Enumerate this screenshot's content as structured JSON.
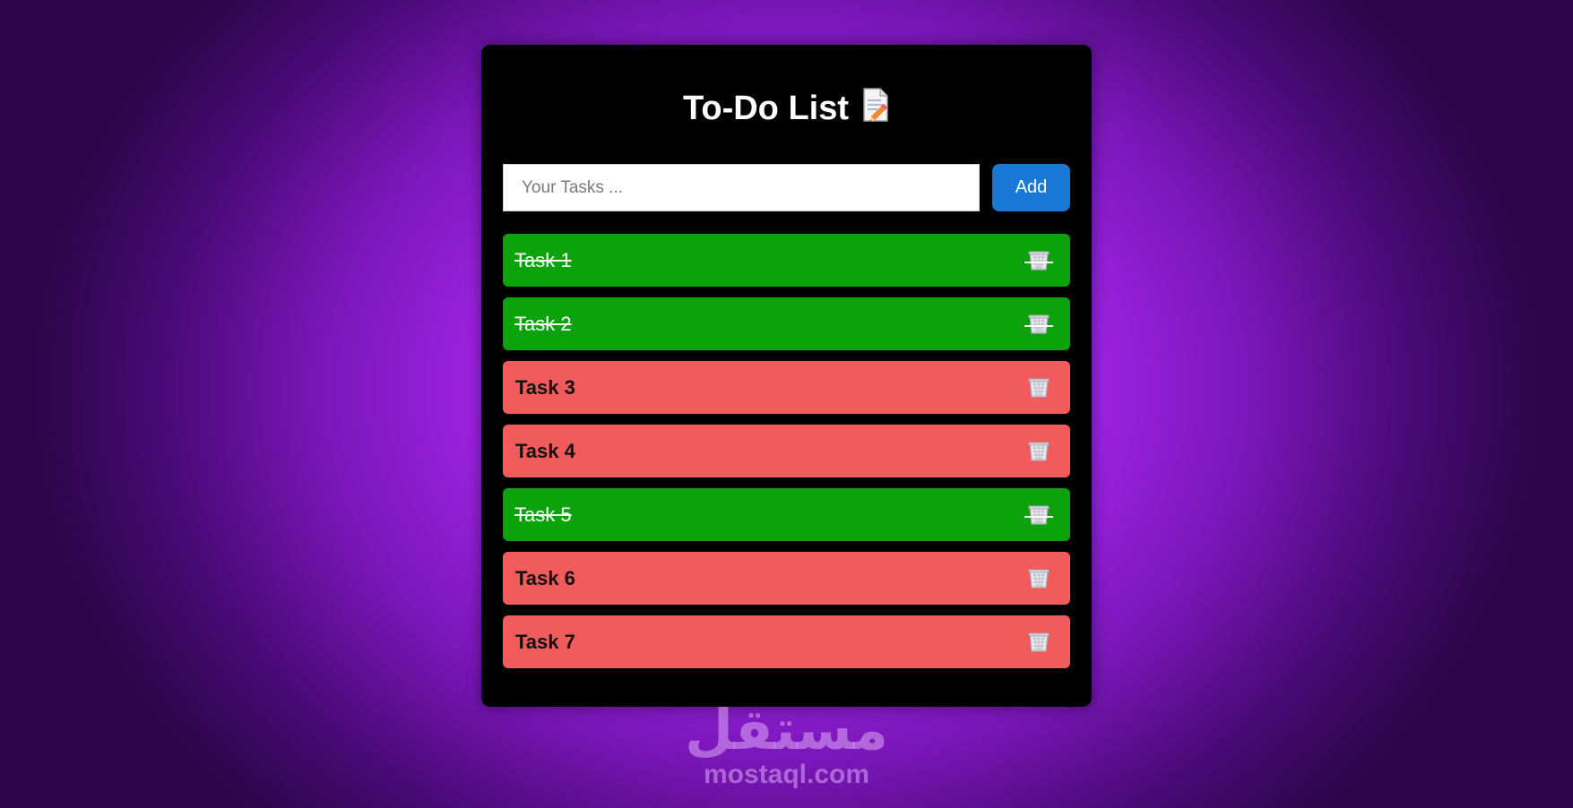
{
  "app": {
    "title": "To-Do List",
    "title_icon": "memo-pencil-icon"
  },
  "input": {
    "placeholder": "Your Tasks ...",
    "value": ""
  },
  "add_button": {
    "label": "Add",
    "color": "#1a78d6"
  },
  "tasks": [
    {
      "label": "Task 1",
      "completed": true
    },
    {
      "label": "Task 2",
      "completed": true
    },
    {
      "label": "Task 3",
      "completed": false
    },
    {
      "label": "Task 4",
      "completed": false
    },
    {
      "label": "Task 5",
      "completed": true
    },
    {
      "label": "Task 6",
      "completed": false
    },
    {
      "label": "Task 7",
      "completed": false
    }
  ],
  "task_delete_icon": "wastebasket-icon",
  "colors": {
    "completed": "#0ca20c",
    "pending": "#f25b5b",
    "card": "#000000",
    "background_accent": "#9a22e0"
  },
  "watermark": {
    "arabic": "مستقل",
    "latin": "mostaql.com"
  }
}
